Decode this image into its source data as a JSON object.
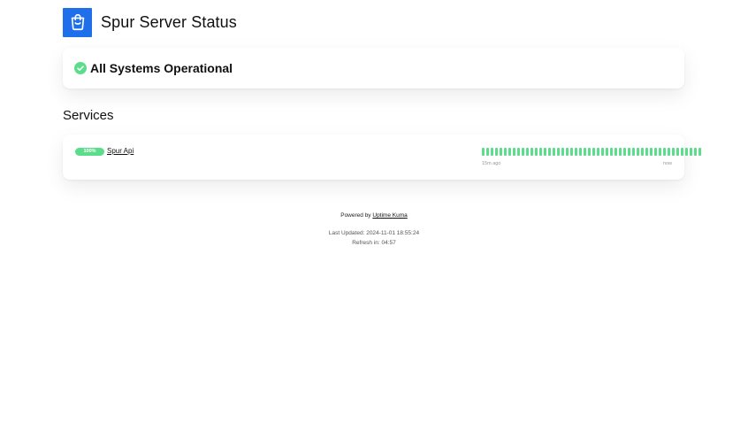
{
  "header": {
    "title": "Spur Server Status",
    "logo_icon": "shopping-bag-icon",
    "logo_color": "#1f6feb"
  },
  "overall": {
    "icon": "check-circle-icon",
    "text": "All Systems Operational",
    "status_color": "#5cdd8b"
  },
  "services": {
    "title": "Services",
    "items": [
      {
        "uptime_badge": "100%",
        "name": "Spur Api",
        "heartbeat_count": 50,
        "heartbeat_color": "#5cdd8b",
        "time_start": "15m ago",
        "time_end": "now"
      }
    ]
  },
  "footer": {
    "powered_prefix": "Powered by",
    "powered_link": "Uptime Kuma",
    "last_updated_label": "Last Updated:",
    "last_updated": "2024-11-01 18:55:24",
    "refresh_label": "Refresh in:",
    "refresh_in": "04:57"
  }
}
